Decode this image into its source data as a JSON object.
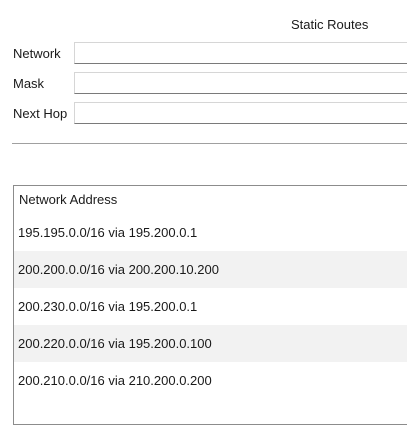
{
  "panel": {
    "title": "Static Routes"
  },
  "form": {
    "network_label": "Network",
    "network_value": "",
    "mask_label": "Mask",
    "mask_value": "",
    "next_hop_label": "Next Hop",
    "next_hop_value": ""
  },
  "routes": {
    "header": "Network Address",
    "items": [
      "195.195.0.0/16 via 195.200.0.1",
      "200.200.0.0/16 via 200.200.10.200",
      "200.230.0.0/16 via 195.200.0.1",
      "200.220.0.0/16 via 195.200.0.100",
      "200.210.0.0/16 via 210.200.0.200"
    ]
  }
}
